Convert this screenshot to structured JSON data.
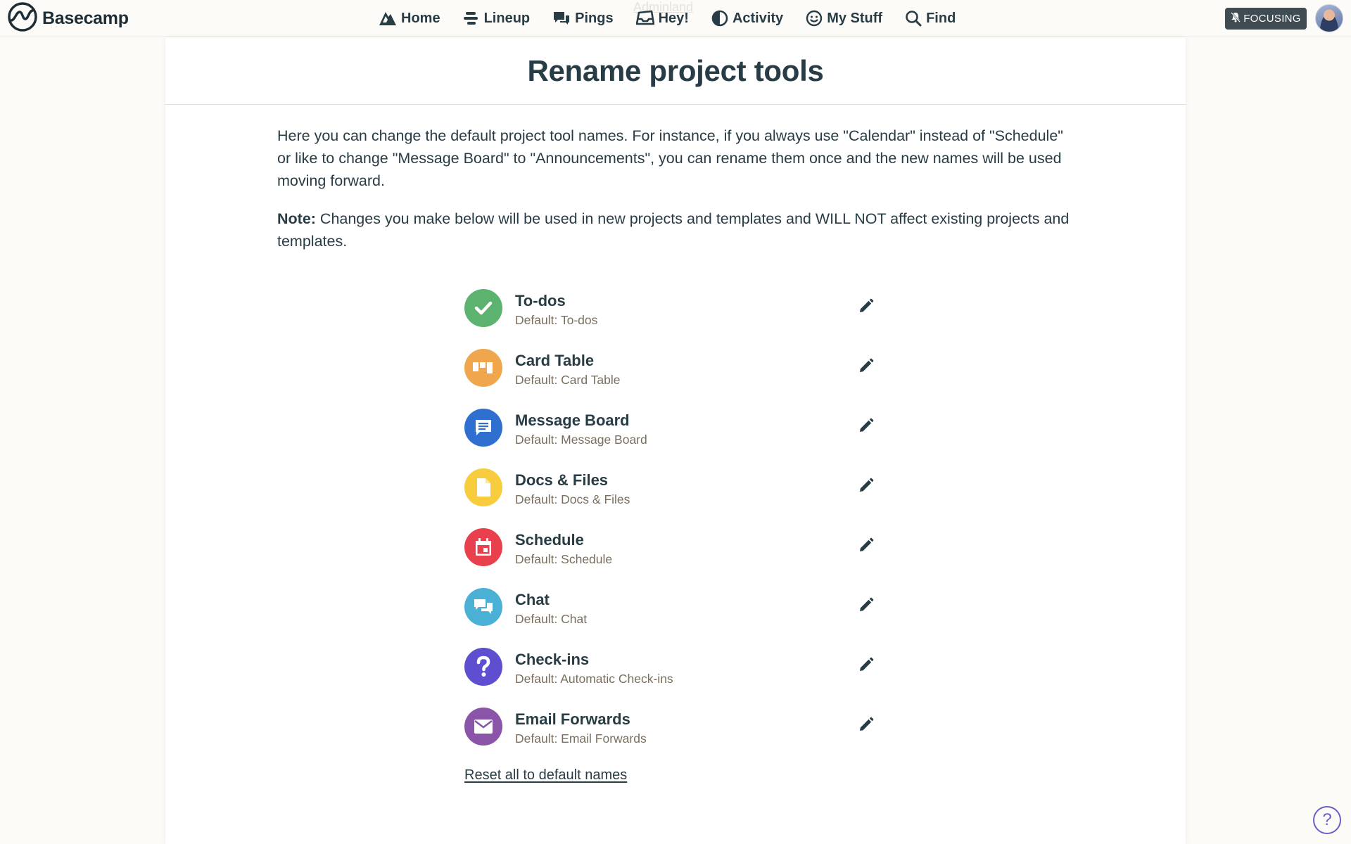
{
  "app": {
    "brand": "Basecamp",
    "logo_icon": "basecamp-logo-icon"
  },
  "nav": {
    "items": [
      {
        "label": "Home",
        "icon": "home-mountain-icon"
      },
      {
        "label": "Lineup",
        "icon": "lineup-icon"
      },
      {
        "label": "Pings",
        "icon": "pings-chat-icon"
      },
      {
        "label": "Hey!",
        "icon": "inbox-tray-icon"
      },
      {
        "label": "Activity",
        "icon": "activity-half-circle-icon"
      },
      {
        "label": "My Stuff",
        "icon": "smiley-face-icon"
      },
      {
        "label": "Find",
        "icon": "magnifier-icon"
      }
    ],
    "ghost_link": "Adminland",
    "focusing_label": "FOCUSING",
    "focusing_icon": "bell-slash-icon"
  },
  "page": {
    "title": "Rename project tools",
    "intro": "Here you can change the default project tool names. For instance, if you always use \"Calendar\" instead of \"Schedule\" or like to change \"Message Board\" to \"Announcements\", you can rename them once and the new names will be used moving forward.",
    "note_label": "Note:",
    "note_text": " Changes you make below will be used in new projects and templates and WILL NOT affect existing projects and templates.",
    "reset_label": "Reset all to default names"
  },
  "tools": [
    {
      "name": "To-dos",
      "default": "Default: To-dos",
      "icon": "checkmark-icon",
      "color": "#5bb36f"
    },
    {
      "name": "Card Table",
      "default": "Default: Card Table",
      "icon": "card-table-icon",
      "color": "#f0a64c"
    },
    {
      "name": "Message Board",
      "default": "Default: Message Board",
      "icon": "message-board-icon",
      "color": "#2f6fd0"
    },
    {
      "name": "Docs & Files",
      "default": "Default: Docs & Files",
      "icon": "document-icon",
      "color": "#f7cd3e"
    },
    {
      "name": "Schedule",
      "default": "Default: Schedule",
      "icon": "calendar-icon",
      "color": "#e8414d"
    },
    {
      "name": "Chat",
      "default": "Default: Chat",
      "icon": "chat-bubbles-icon",
      "color": "#4ab0d6"
    },
    {
      "name": "Check-ins",
      "default": "Default: Automatic Check-ins",
      "icon": "question-mark-icon",
      "color": "#5d4fcf"
    },
    {
      "name": "Email Forwards",
      "default": "Default: Email Forwards",
      "icon": "envelope-icon",
      "color": "#8a55a8"
    }
  ],
  "help": {
    "label": "?",
    "icon": "help-question-icon",
    "color": "#6a5fc8"
  }
}
